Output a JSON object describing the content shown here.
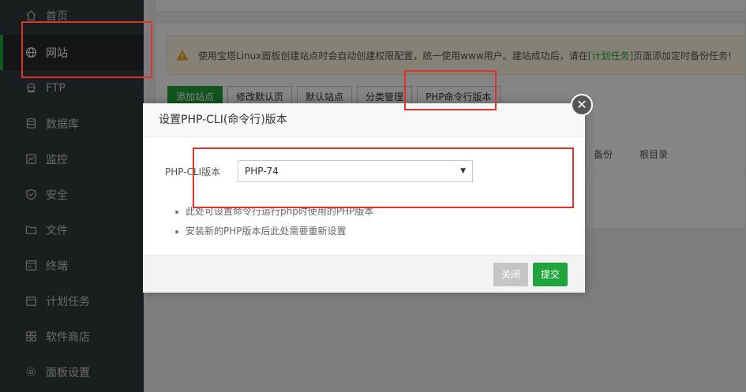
{
  "sidebar": {
    "items": [
      {
        "label": "首页",
        "icon": "home-icon"
      },
      {
        "label": "网站",
        "icon": "globe-icon",
        "active": true
      },
      {
        "label": "FTP",
        "icon": "ftp-icon"
      },
      {
        "label": "数据库",
        "icon": "database-icon"
      },
      {
        "label": "监控",
        "icon": "monitor-icon"
      },
      {
        "label": "安全",
        "icon": "shield-icon"
      },
      {
        "label": "文件",
        "icon": "folder-icon"
      },
      {
        "label": "终端",
        "icon": "terminal-icon"
      },
      {
        "label": "计划任务",
        "icon": "calendar-icon"
      },
      {
        "label": "软件商店",
        "icon": "apps-icon"
      },
      {
        "label": "面板设置",
        "icon": "gear-icon"
      }
    ]
  },
  "notice": {
    "text_before": "使用宝塔Linux面板创建站点时会自动创建权限配置，统一使用www用户。建站成功后，请在",
    "link": "[计划任务]",
    "text_after": "页面添加定时备份任务!"
  },
  "toolbar": {
    "add_site": "添加站点",
    "edit_default_page": "修改默认页",
    "default_site": "默认站点",
    "category_manage": "分类管理",
    "php_cli_version": "PHP命令行版本"
  },
  "table": {
    "headers": [
      "备份",
      "根目录"
    ]
  },
  "dialog": {
    "title": "设置PHP-CLI(命令行)版本",
    "field_label": "PHP-CLI版本",
    "selected_version": "PHP-74",
    "tips": [
      "此处可设置命令行运行php时使用的PHP版本",
      "安装新的PHP版本后此处需要重新设置"
    ],
    "close_label": "关闭",
    "submit_label": "提交"
  },
  "colors": {
    "accent": "#20a53a",
    "sidebar_bg": "#313a3f",
    "annotation_red": "#e0312f"
  }
}
